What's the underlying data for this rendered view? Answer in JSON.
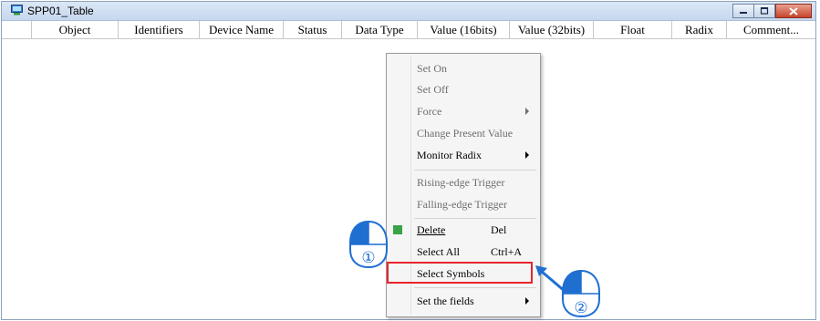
{
  "window": {
    "title": "SPP01_Table",
    "controls": {
      "minimize": "minimize",
      "maximize": "maximize",
      "close": "close"
    }
  },
  "table": {
    "columns": [
      "Object",
      "Identifiers",
      "Device Name",
      "Status",
      "Data Type",
      "Value (16bits)",
      "Value (32bits)",
      "Float",
      "Radix",
      "Comment..."
    ]
  },
  "context_menu": {
    "items": [
      {
        "label": "Set On",
        "enabled": false
      },
      {
        "label": "Set Off",
        "enabled": false
      },
      {
        "label": "Force",
        "enabled": false,
        "submenu": true
      },
      {
        "label": "Change Present Value",
        "enabled": false
      },
      {
        "label": "Monitor Radix",
        "enabled": true,
        "submenu": true
      },
      {
        "label": "Rising-edge Trigger",
        "enabled": false
      },
      {
        "label": "Falling-edge Trigger",
        "enabled": false
      },
      {
        "label": "Delete",
        "shortcut": "Del",
        "enabled": true
      },
      {
        "label": "Select All",
        "shortcut": "Ctrl+A",
        "enabled": true
      },
      {
        "label": "Select Symbols",
        "enabled": true,
        "highlighted": true
      },
      {
        "label": "Set the fields",
        "enabled": true,
        "submenu": true
      }
    ]
  },
  "annotations": {
    "step1": "①",
    "step2": "②",
    "highlight_color": "#e8242c",
    "arrow_color": "#1f6fd1"
  }
}
